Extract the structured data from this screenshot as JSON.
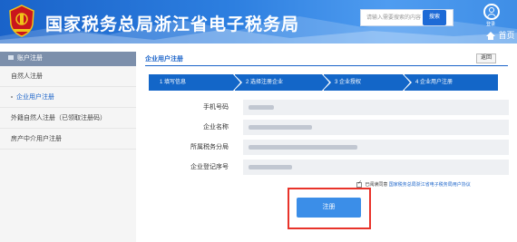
{
  "header": {
    "site_title": "国家税务总局浙江省电子税务局",
    "search_placeholder": "请输入需要搜索的内容",
    "search_button": "搜索",
    "login_label": "登录",
    "home_label": "首页"
  },
  "sidebar": {
    "heading": "账户注册",
    "items": [
      {
        "label": "自然人注册",
        "active": false
      },
      {
        "label": "企业用户注册",
        "active": true
      },
      {
        "label": "外籍自然人注册（已领取注册码）",
        "active": false
      },
      {
        "label": "房产中介用户注册",
        "active": false
      }
    ]
  },
  "main": {
    "title": "企业用户注册",
    "back_button": "返回",
    "steps": [
      {
        "label": "1  填写信息"
      },
      {
        "label": "2  选择注册企业"
      },
      {
        "label": "3  企业授权"
      },
      {
        "label": "4  企业用户注册"
      }
    ],
    "form": [
      {
        "label": "手机号码"
      },
      {
        "label": "企业名称"
      },
      {
        "label": "所属税务分局"
      },
      {
        "label": "企业登记序号"
      }
    ],
    "agree_prefix": "已阅读同意",
    "agree_link": "国家税务总局浙江省电子税务局用户协议",
    "submit_button": "注册"
  },
  "colors": {
    "primary": "#1a63c9",
    "step_blue": "#1366c8",
    "highlight_red": "#e8332a",
    "button_blue": "#3b8ee8"
  }
}
